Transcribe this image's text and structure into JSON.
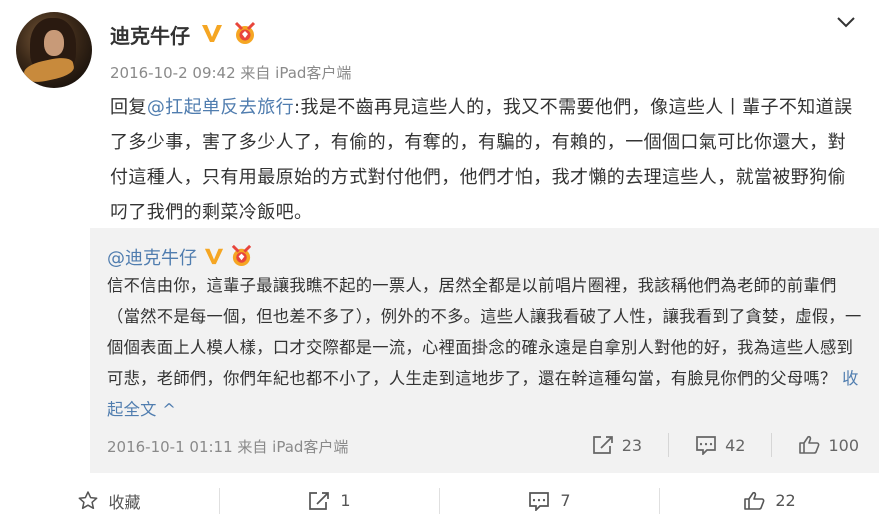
{
  "post": {
    "author": "迪克牛仔",
    "date": "2016-10-2 09:42",
    "source": "来自 iPad客户端",
    "reply_prefix": "回复",
    "reply_mention": "@扛起单反去旅行",
    "reply_text": ":我是不齒再見這些人的，我又不需要他們，像這些人丨輩子不知道誤了多少事，害了多少人了，有偷的，有奪的，有騙的，有賴的，一個個口氣可比你還大，對付這種人，只有用最原始的方式對付他們，他們才怕，我才懶的去理這些人，就當被野狗偷叼了我們的剩菜冷飯吧。"
  },
  "quoted": {
    "author": "@迪克牛仔",
    "text": "信不信由你，這輩子最讓我瞧不起的一票人，居然全都是以前唱片圈裡，我該稱他們為老師的前輩們（當然不是每一個，但也差不多了），例外的不多。這些人讓我看破了人性，讓我看到了貪婪，虛假，一個個表面上人模人樣，口才交際都是一流，心裡面掛念的確永遠是自拿別人對他的好，我為這些人感到可悲，老師們，你們年紀也都不小了，人生走到這地步了，還在幹這種勾當，有臉見你們的父母嗎？ ",
    "collapse_label": "收起全文 ^",
    "date": "2016-10-1 01:11",
    "source": "来自 iPad客户端",
    "reposts": "23",
    "comments": "42",
    "likes": "100"
  },
  "actions": {
    "favorite": "收藏",
    "repost": "1",
    "comment": "7",
    "like": "22"
  },
  "colors": {
    "link": "#507daf",
    "badge_gold": "#f5a623",
    "quote_bg": "#f2f2f2"
  },
  "icons": [
    "chevron-down-icon",
    "verified-v-icon",
    "medal-icon",
    "repost-icon",
    "comment-icon",
    "like-icon",
    "star-icon"
  ]
}
